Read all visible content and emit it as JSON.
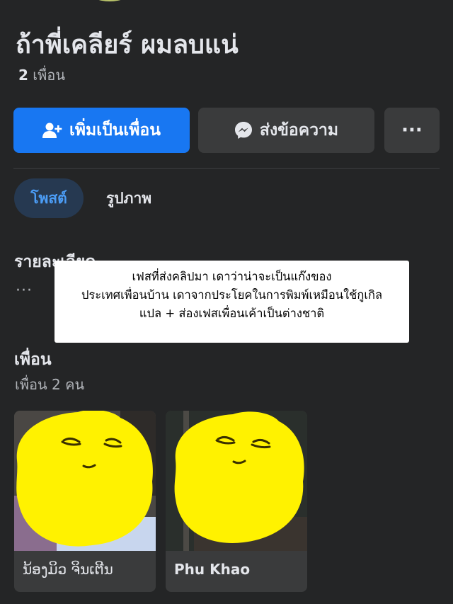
{
  "profile": {
    "name": "ถ้าพี่เคลียร์ ผมลบแน่",
    "friend_count": "2",
    "friend_count_label": "เพื่อน"
  },
  "actions": {
    "add_friend_label": "เพิ่มเป็นเพื่อน",
    "message_label": "ส่งข้อความ",
    "more_label": "···"
  },
  "tabs": [
    {
      "label": "โพสต์",
      "active": true
    },
    {
      "label": "รูปภาพ",
      "active": false
    }
  ],
  "details": {
    "title": "รายละเอียด",
    "more": "···"
  },
  "overlay_caption": {
    "lines": [
      "เฟสที่ส่งคลิปมา เดาว่าน่าจะเป็นแก๊งของ",
      "ประเทศเพื่อนบ้าน เดาจากประโยคในการพิมพ์เหมือนใช้กูเกิล",
      "แปล + ส่องเฟสเพื่อนเค้าเป็นต่างชาติ"
    ]
  },
  "friends": {
    "title": "เพื่อน",
    "subtitle": "เพื่อน 2 คน",
    "items": [
      {
        "name": "ນ້ອງມິວ ຈິນເຕີນ"
      },
      {
        "name": "Phu Khao"
      }
    ]
  },
  "colors": {
    "background": "#242526",
    "primary": "#1877f2",
    "secondary_button": "#3a3b3c",
    "active_tab_bg": "#263951",
    "active_tab_text": "#4b9cf5",
    "sticker_yellow": "#fff200"
  },
  "icons": {
    "add_friend": "person-plus-icon",
    "message": "messenger-icon",
    "more": "more-dots-icon"
  }
}
